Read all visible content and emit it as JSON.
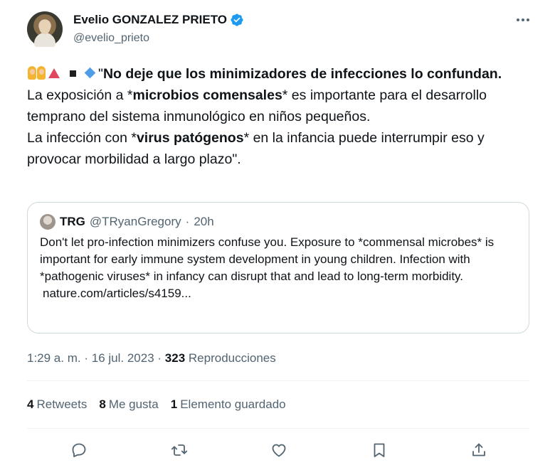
{
  "author": {
    "name": "Evelio GONZALEZ PRIETO",
    "handle": "@evelio_prieto"
  },
  "tweet": {
    "emoji_icons": [
      "girls-emoji",
      "red-triangle-emoji",
      "black-square-emoji",
      "blue-diamond-emoji"
    ],
    "intro": "\"",
    "bold_heading": "No deje que los minimizadores de infecciones lo confundan.",
    "line2_a": "La exposición a *",
    "line2_bold": "microbios comensales",
    "line2_b": "* es importante para el desarrollo temprano del sistema inmunológico en niños pequeños.",
    "line3_a": "La infección con *",
    "line3_bold": "virus patógenos",
    "line3_b": "* en la infancia puede interrumpir eso y provocar morbilidad a largo plazo\"."
  },
  "quote": {
    "name": "TRG",
    "handle": "@TRyanGregory",
    "separator": "·",
    "time": "20h",
    "text": "Don't let pro-infection minimizers confuse you. Exposure to *commensal microbes* is important for early immune system development in young children. Infection with *pathogenic viruses* in infancy can disrupt that and lead to long-term morbidity.",
    "link": "nature.com/articles/s4159..."
  },
  "meta": {
    "time": "1:29 a. m.",
    "sep1": "·",
    "date": "16 jul. 2023",
    "sep2": "·",
    "views_count": "323",
    "views_label": "Reproducciones"
  },
  "stats": {
    "retweets_count": "4",
    "retweets_label": "Retweets",
    "likes_count": "8",
    "likes_label": "Me gusta",
    "bookmarks_count": "1",
    "bookmarks_label": "Elemento guardado"
  },
  "actions": [
    "reply-icon",
    "retweet-icon",
    "like-icon",
    "bookmark-icon",
    "share-icon"
  ],
  "colors": {
    "verified": "#1d9bf0",
    "secondary_text": "#536471",
    "border": "#cfd9de"
  }
}
